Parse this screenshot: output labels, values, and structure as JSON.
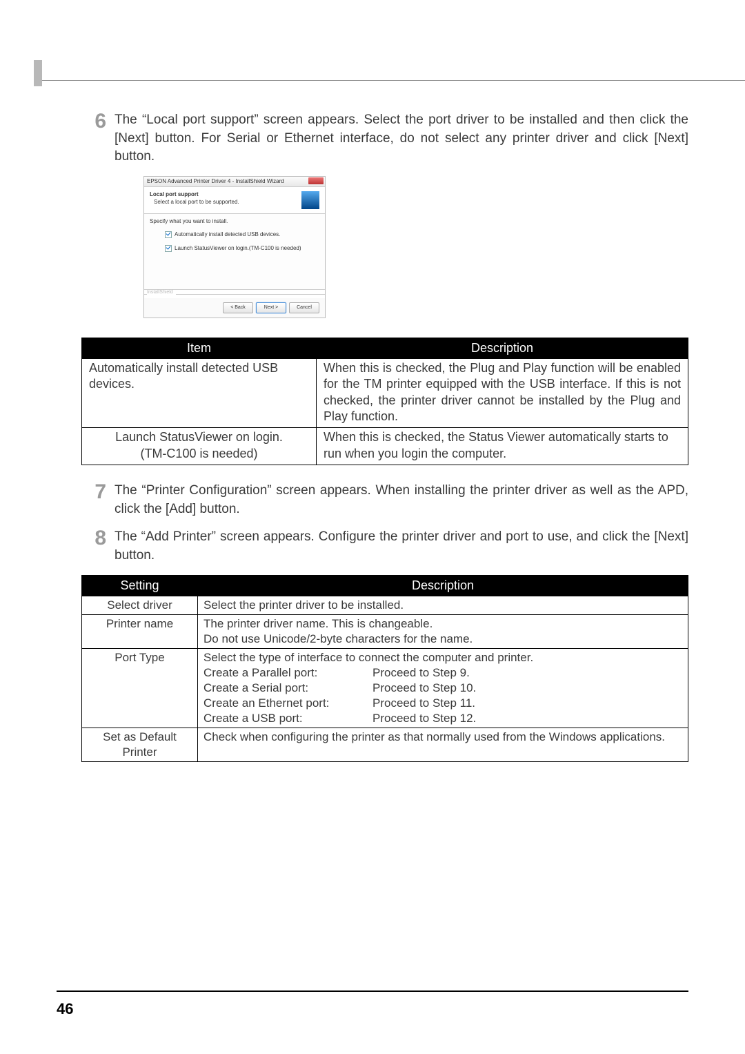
{
  "steps": {
    "s6": {
      "num": "6",
      "text": "The “Local port support” screen appears. Select the port driver to be installed and then click the [Next] button. For Serial or Ethernet interface, do not select any printer driver and click [Next] button."
    },
    "s7": {
      "num": "7",
      "text": "The “Printer Configuration” screen appears. When installing the printer driver as well as the APD, click the [Add] button."
    },
    "s8": {
      "num": "8",
      "text": "The “Add Printer” screen appears. Configure the printer driver and port to use, and click the [Next] button."
    }
  },
  "dialog": {
    "title": "EPSON Advanced Printer Driver 4 - InstallShield Wizard",
    "banner_title": "Local port support",
    "banner_sub": "Select a local port to be supported.",
    "specify": "Specify what you want to install.",
    "chk1": "Automatically install detected USB devices.",
    "chk2": "Launch StatusViewer on login.(TM-C100 is needed)",
    "brand": "InstallShield",
    "back": "< Back",
    "next": "Next >",
    "cancel": "Cancel"
  },
  "table1": {
    "headers": {
      "item": "Item",
      "desc": "Description"
    },
    "rows": [
      {
        "item": "Automatically install detected USB devices.",
        "desc": "When this is checked, the Plug and Play function will be enabled for the TM printer equipped with the USB interface. If this is not checked, the printer driver cannot be installed by the Plug and Play function."
      },
      {
        "item_a": "Launch StatusViewer on login.",
        "item_b": "(TM-C100 is needed)",
        "desc": "When this is checked, the Status Viewer automatically starts to run when you login the computer."
      }
    ]
  },
  "table2": {
    "headers": {
      "setting": "Setting",
      "desc": "Description"
    },
    "rows": {
      "r0": {
        "setting": "Select driver",
        "desc": "Select the printer driver to be installed."
      },
      "r1": {
        "setting": "Printer name",
        "desc": "The printer driver name. This is changeable.\nDo not use Unicode/2-byte characters for the name."
      },
      "r2": {
        "setting": "Port Type",
        "intro": "Select the type of interface to connect the computer and printer.",
        "ports": [
          {
            "left": "Create a Parallel port:",
            "right": "Proceed to Step 9."
          },
          {
            "left": "Create a Serial port:",
            "right": "Proceed to Step 10."
          },
          {
            "left": "Create an Ethernet port:",
            "right": "Proceed to Step 11."
          },
          {
            "left": "Create a USB port:",
            "right": "Proceed to Step 12."
          }
        ]
      },
      "r3": {
        "setting": "Set as Default Printer",
        "desc": "Check when configuring the printer as that normally used from the Windows applications."
      }
    }
  },
  "page_num": "46"
}
